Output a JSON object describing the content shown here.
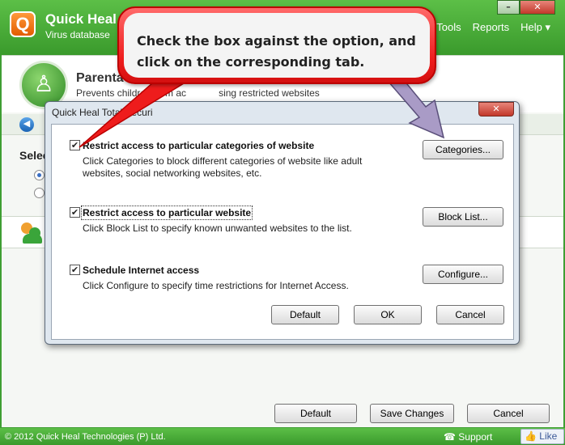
{
  "app": {
    "name": "Quick Heal",
    "subtitle": "Virus database",
    "menu": [
      "Tools",
      "Reports",
      "Help ▾"
    ],
    "window_min": "–",
    "window_close": "✕"
  },
  "page": {
    "title": "Parenta",
    "subtitle": "Prevents children from ac",
    "subtitle_tail": "sing restricted websites",
    "select_label": "Selec"
  },
  "bottom_buttons": {
    "default": "Default",
    "save": "Save Changes",
    "cancel": "Cancel"
  },
  "footer": {
    "copyright": "© 2012 Quick Heal Technologies (P) Ltd.",
    "support": "Support",
    "like": "Like"
  },
  "dialog": {
    "title": "Quick Heal Total Securi",
    "close": "✕",
    "options": [
      {
        "label": "Restrict access to particular categories of website",
        "description": "Click Categories to block different categories of website like adult websites, social networking websites, etc.",
        "button": "Categories...",
        "checked": true
      },
      {
        "label": "Restrict access to particular website",
        "description": "Click Block List to specify known unwanted websites to the list.",
        "button": "Block List...",
        "checked": true
      },
      {
        "label": "Schedule Internet access",
        "description": "Click Configure to specify time restrictions for Internet Access.",
        "button": "Configure...",
        "checked": true
      }
    ],
    "buttons": {
      "default": "Default",
      "ok": "OK",
      "cancel": "Cancel"
    }
  },
  "callout": {
    "text": "Check the box against the option, and click on the corresponding tab."
  },
  "colors": {
    "brand_green": "#3a9a2c",
    "callout_red": "#ee1c1c",
    "arrow_purple": "#a99bc6"
  }
}
